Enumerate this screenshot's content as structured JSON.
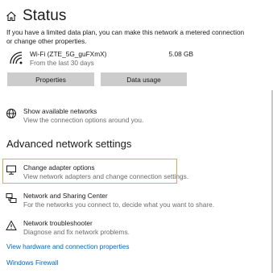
{
  "header": {
    "title": "Status"
  },
  "intro": "If you have a limited data plan, you can make this network a metered connection or change other properties.",
  "network": {
    "name": "Wi-Fi (ZTE_5G_guFXmX)",
    "period": "From the last 30 days",
    "usage": "5.08 GB"
  },
  "buttons": {
    "properties": "Properties",
    "data_usage": "Data usage"
  },
  "show_networks": {
    "title": "Show available networks",
    "desc": "View the connection options around you."
  },
  "advanced": {
    "heading": "Advanced network settings",
    "items": [
      {
        "title": "Change adapter options",
        "desc": "View network adapters and change connection settings."
      },
      {
        "title": "Network and Sharing Center",
        "desc": "For the networks you connect to, decide what you want to share."
      },
      {
        "title": "Network troubleshooter",
        "desc": "Diagnose and fix network problems."
      }
    ]
  },
  "links": {
    "hardware": "View hardware and connection properties",
    "firewall": "Windows Firewall"
  },
  "colors": {
    "link": "#0067c0",
    "highlight": "#f3a34a",
    "button": "#cccccc"
  }
}
